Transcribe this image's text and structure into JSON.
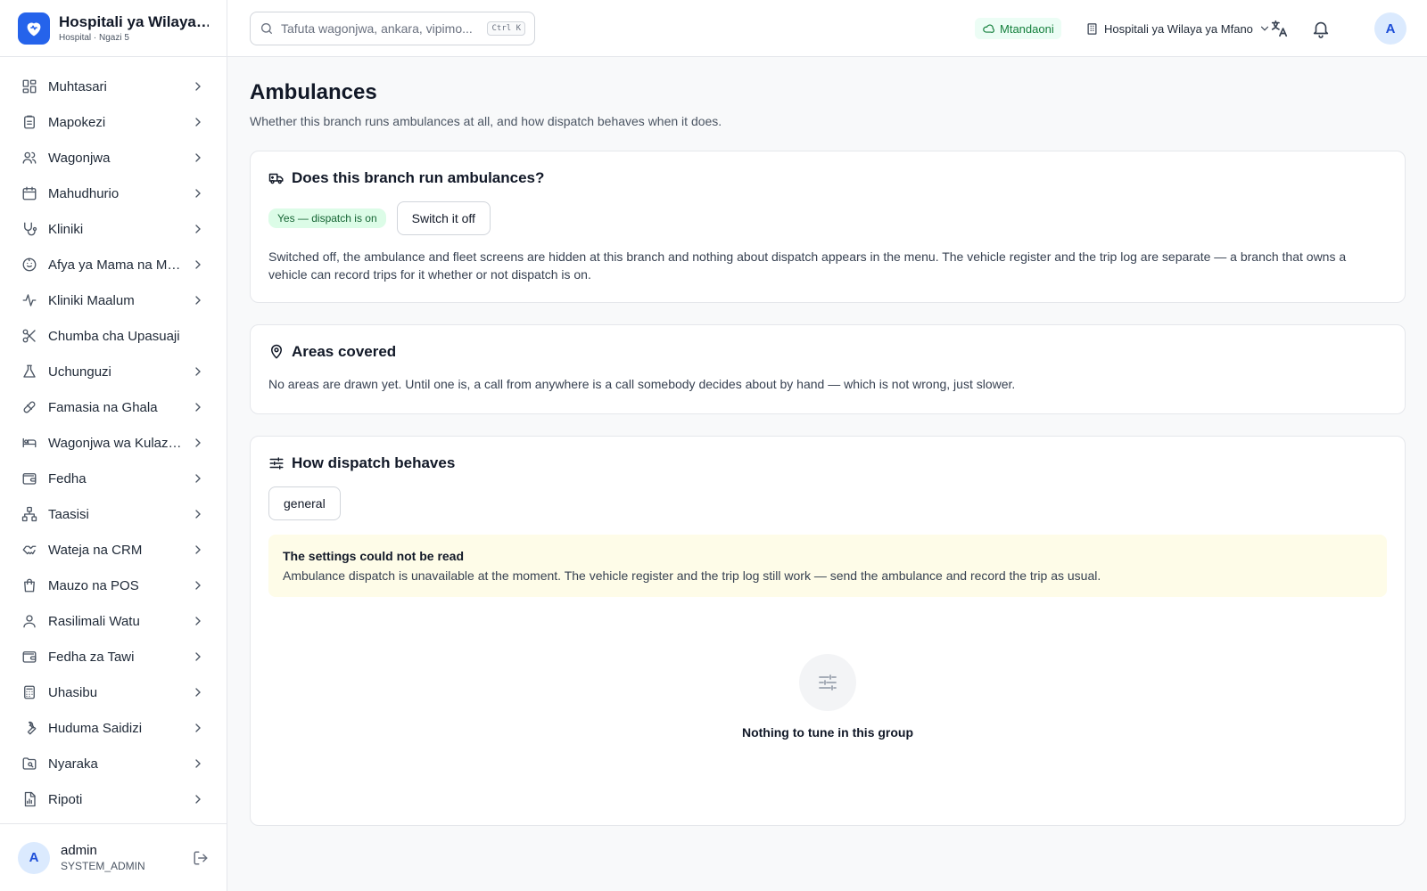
{
  "brand": {
    "title": "Hospitali ya Wilaya ya Mfano",
    "subtitle": "Hospital · Ngazi 5"
  },
  "sidebar": {
    "items": [
      {
        "label": "Muhtasari",
        "icon": "dashboard-icon",
        "chevron": true
      },
      {
        "label": "Mapokezi",
        "icon": "clipboard-icon",
        "chevron": true
      },
      {
        "label": "Wagonjwa",
        "icon": "users-icon",
        "chevron": true
      },
      {
        "label": "Mahudhurio",
        "icon": "calendar-icon",
        "chevron": true
      },
      {
        "label": "Kliniki",
        "icon": "stethoscope-icon",
        "chevron": true
      },
      {
        "label": "Afya ya Mama na Mtoto",
        "icon": "baby-icon",
        "chevron": true
      },
      {
        "label": "Kliniki Maalum",
        "icon": "activity-icon",
        "chevron": true
      },
      {
        "label": "Chumba cha Upasuaji",
        "icon": "scissors-icon",
        "chevron": false
      },
      {
        "label": "Uchunguzi",
        "icon": "flask-icon",
        "chevron": true
      },
      {
        "label": "Famasia na Ghala",
        "icon": "pill-icon",
        "chevron": true
      },
      {
        "label": "Wagonjwa wa Kulazwa",
        "icon": "bed-icon",
        "chevron": true
      },
      {
        "label": "Fedha",
        "icon": "wallet-icon",
        "chevron": true
      },
      {
        "label": "Taasisi",
        "icon": "network-icon",
        "chevron": true
      },
      {
        "label": "Wateja na CRM",
        "icon": "handshake-icon",
        "chevron": true
      },
      {
        "label": "Mauzo na POS",
        "icon": "shopping-bag-icon",
        "chevron": true
      },
      {
        "label": "Rasilimali Watu",
        "icon": "user-group-icon",
        "chevron": true
      },
      {
        "label": "Fedha za Tawi",
        "icon": "wallet-icon",
        "chevron": true
      },
      {
        "label": "Uhasibu",
        "icon": "calculator-icon",
        "chevron": true
      },
      {
        "label": "Huduma Saidizi",
        "icon": "wrench-icon",
        "chevron": true
      },
      {
        "label": "Nyaraka",
        "icon": "folder-icon",
        "chevron": true
      },
      {
        "label": "Ripoti",
        "icon": "report-icon",
        "chevron": true
      }
    ]
  },
  "user": {
    "initial": "A",
    "name": "admin",
    "role": "SYSTEM_ADMIN"
  },
  "topbar": {
    "search_placeholder": "Tafuta wagonjwa, ankara, vipimo...",
    "shortcut": "Ctrl K",
    "status": "Mtandaoni",
    "branch": "Hospitali ya Wilaya ya Mfano",
    "avatar_initial": "A"
  },
  "page": {
    "title": "Ambulances",
    "description": "Whether this branch runs ambulances at all, and how dispatch behaves when it does."
  },
  "card_run": {
    "title": "Does this branch run ambulances?",
    "badge": "Yes — dispatch is on",
    "button": "Switch it off",
    "text": "Switched off, the ambulance and fleet screens are hidden at this branch and nothing about dispatch appears in the menu. The vehicle register and the trip log are separate — a branch that owns a vehicle can record trips for it whether or not dispatch is on."
  },
  "card_areas": {
    "title": "Areas covered",
    "text": "No areas are drawn yet. Until one is, a call from anywhere is a call somebody decides about by hand — which is not wrong, just slower."
  },
  "card_dispatch": {
    "title": "How dispatch behaves",
    "group_button": "general",
    "alert_title": "The settings could not be read",
    "alert_text": "Ambulance dispatch is unavailable at the moment. The vehicle register and the trip log still work — send the ambulance and record the trip as usual.",
    "empty_text": "Nothing to tune in this group"
  },
  "colors": {
    "brand": "#2563eb",
    "online_bg": "#ecfdf5",
    "online_text": "#15803d",
    "badge_bg": "#dcfce7",
    "alert_bg": "#fefce8"
  }
}
